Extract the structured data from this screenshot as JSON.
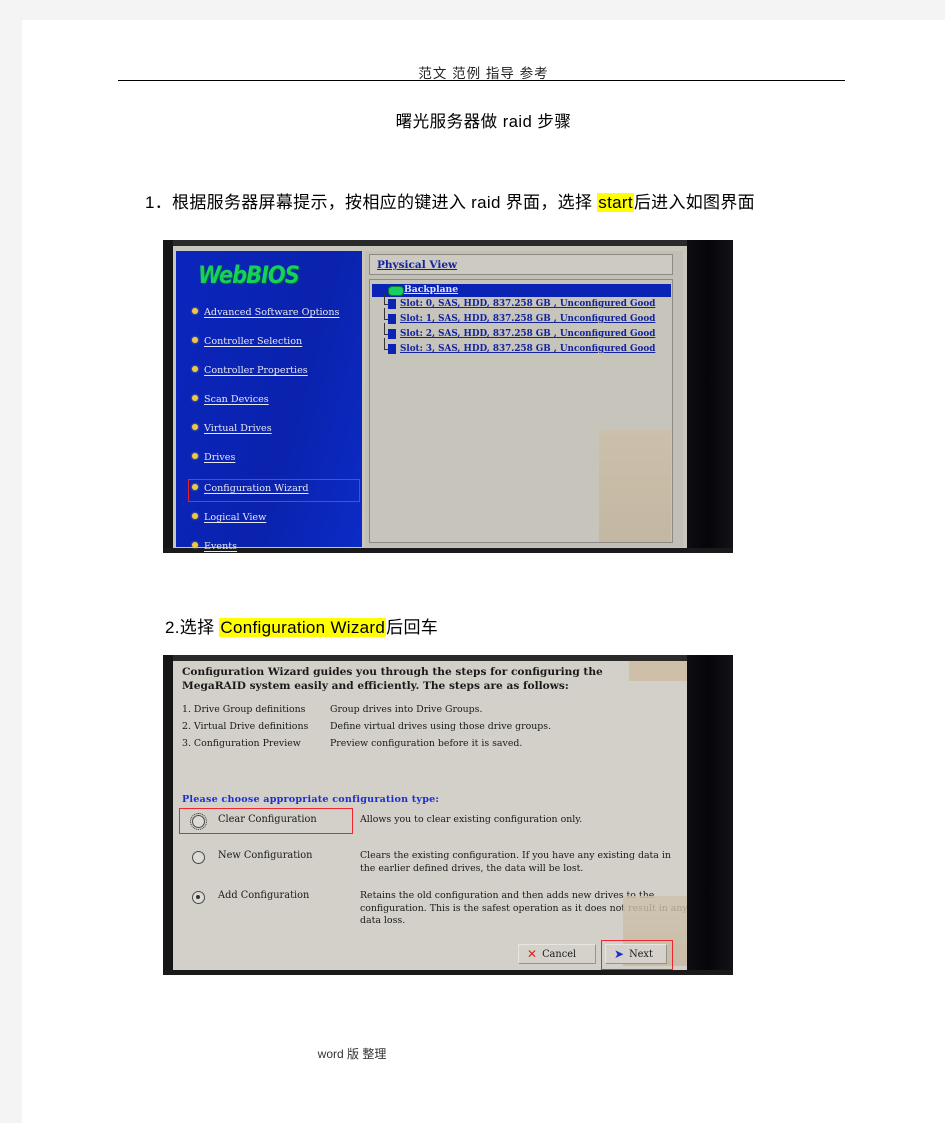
{
  "document": {
    "header_text": "范文 范例 指导  参考",
    "title": "曙光服务器做 raid 步骤",
    "footer_text": "word 版 整理"
  },
  "steps": {
    "step1": {
      "pre": "1．根据服务器屏幕提示，按相应的键进入 raid 界面，选择 ",
      "highlight": "start",
      "post": "后进入如图界面"
    },
    "step2": {
      "pre": "2.选择 ",
      "highlight": "Configuration  Wizard",
      "post": "后回车"
    }
  },
  "webbios_screenshot": {
    "logo": "WebBIOS",
    "menu_items": [
      {
        "label": "Advanced Software Options"
      },
      {
        "label": "Controller Selection"
      },
      {
        "label": "Controller Properties"
      },
      {
        "label": "Scan Devices"
      },
      {
        "label": "Virtual Drives"
      },
      {
        "label": "Drives"
      },
      {
        "label": "Configuration Wizard"
      },
      {
        "label": "Logical View"
      },
      {
        "label": "Events"
      }
    ],
    "highlighted_menu_item": "Configuration Wizard",
    "panel_title": "Physical View",
    "tree_root": "Backplane",
    "drives": [
      {
        "label": "Slot: 0, SAS, HDD, 837.258 GB , Unconfigured Good"
      },
      {
        "label": "Slot: 1, SAS, HDD, 837.258 GB , Unconfigured Good"
      },
      {
        "label": "Slot: 2, SAS, HDD, 837.258 GB , Unconfigured Good"
      },
      {
        "label": "Slot: 3, SAS, HDD, 837.258 GB , Unconfigured Good"
      }
    ]
  },
  "wizard_screenshot": {
    "intro": "Configuration Wizard guides you through the steps for configuring the MegaRAID system easily and efficiently. The steps are as follows:",
    "steps": [
      {
        "num": "1. Drive Group definitions",
        "desc": "Group drives into Drive Groups."
      },
      {
        "num": "2. Virtual Drive definitions",
        "desc": "Define virtual drives using those drive groups."
      },
      {
        "num": "3. Configuration Preview",
        "desc": "Preview configuration before it is saved."
      }
    ],
    "choose_prompt": "Please choose appropriate configuration type:",
    "options": [
      {
        "label": "Clear Configuration",
        "desc": "Allows you to clear existing configuration only."
      },
      {
        "label": "New Configuration",
        "desc": "Clears the existing configuration. If you have any existing data in the earlier defined drives, the data will be lost."
      },
      {
        "label": "Add Configuration",
        "desc": "Retains the old configuration and then adds new drives to the configuration. This is the safest operation as it does not result in any data loss."
      }
    ],
    "selected_option": "Add Configuration",
    "highlighted_option": "Clear Configuration",
    "buttons": {
      "cancel": "Cancel",
      "next": "Next"
    },
    "highlighted_button": "Next"
  },
  "colors": {
    "highlight_yellow": "#ffff00",
    "annotation_red": "#f0262f",
    "bios_blue": "#0a23b4",
    "link_blue": "#12239e"
  }
}
